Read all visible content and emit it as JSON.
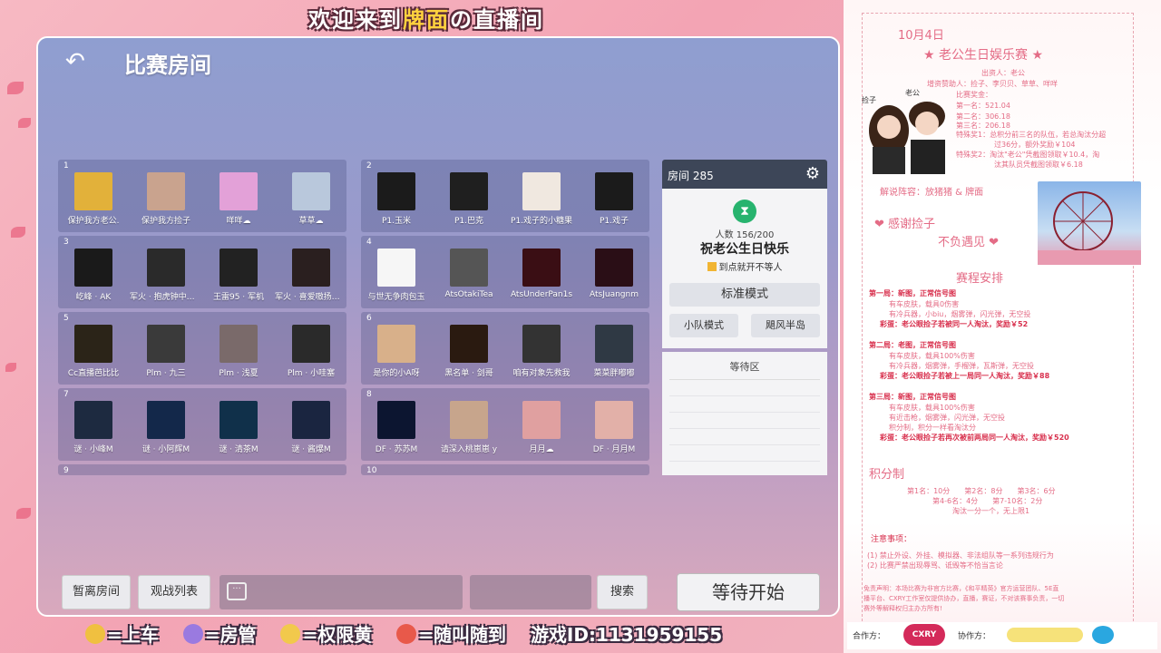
{
  "banner": {
    "part1": "欢迎来到",
    "highlight": "牌面",
    "part2": "の直播间"
  },
  "game": {
    "title": "比赛房间",
    "teams": [
      {
        "num": "1",
        "members": [
          {
            "name": "保护我方老公.",
            "color": "#e2b13a"
          },
          {
            "name": "保护我方捡子",
            "color": "#c9a38e"
          },
          {
            "name": "咩咩☁",
            "color": "#e3a1d8"
          },
          {
            "name": "草草☁",
            "color": "#b9c8dc"
          }
        ]
      },
      {
        "num": "2",
        "members": [
          {
            "name": "P1.玉米",
            "color": "#1b1b1b"
          },
          {
            "name": "P1.巴克",
            "color": "#1f1f1f"
          },
          {
            "name": "P1.戏子的小糖果",
            "color": "#f0e8e0"
          },
          {
            "name": "P1.戏子",
            "color": "#1b1b1b"
          }
        ]
      },
      {
        "num": "3",
        "members": [
          {
            "name": "屹峰 · AK",
            "color": "#1a1a1a"
          },
          {
            "name": "军火 · 抱虎钟中很苍鸭",
            "color": "#2a2a2a"
          },
          {
            "name": "王雷95 · 军机",
            "color": "#222"
          },
          {
            "name": "军火 · 喜爱嗷扬巴瓦别哥",
            "color": "#2a1f1f"
          }
        ]
      },
      {
        "num": "4",
        "members": [
          {
            "name": "与世无争肉包玉",
            "color": "#f6f6f6"
          },
          {
            "name": "AtsOtakiTea",
            "color": "#555"
          },
          {
            "name": "AtsUnderPan1s",
            "color": "#3a0e14"
          },
          {
            "name": "AtsJuangnm",
            "color": "#2a0e16"
          }
        ]
      },
      {
        "num": "5",
        "members": [
          {
            "name": "Cc直播芭比比",
            "color": "#2b2418"
          },
          {
            "name": "Plm · 九三",
            "color": "#3a3a3a"
          },
          {
            "name": "Plm · 浅夏",
            "color": "#7a6a6a"
          },
          {
            "name": "Plm · 小哇塞",
            "color": "#2a2a2a"
          }
        ]
      },
      {
        "num": "6",
        "members": [
          {
            "name": "是你的小A呀",
            "color": "#d8b08a"
          },
          {
            "name": "黑名单 · 剑哥",
            "color": "#2a1a10"
          },
          {
            "name": "咱有对象先救我",
            "color": "#333"
          },
          {
            "name": "菜菜胖嘟嘟",
            "color": "#2f3944"
          }
        ]
      },
      {
        "num": "7",
        "members": [
          {
            "name": "谜 · 小峰M",
            "color": "#1d2a40"
          },
          {
            "name": "谜 · 小阿辉M",
            "color": "#13284a"
          },
          {
            "name": "谜 · 清茶M",
            "color": "#10304a"
          },
          {
            "name": "谜 · 酱爆M",
            "color": "#1a2540"
          }
        ]
      },
      {
        "num": "8",
        "members": [
          {
            "name": "DF · 苏苏M",
            "color": "#0c1530"
          },
          {
            "name": "请深入桃崽崽 y",
            "color": "#c7a58c"
          },
          {
            "name": "月月☁",
            "color": "#e0a0a0"
          },
          {
            "name": "DF · 月月M",
            "color": "#e2b0a8"
          }
        ]
      },
      {
        "num": "9",
        "members": []
      },
      {
        "num": "10",
        "members": []
      }
    ],
    "room": {
      "label": "房间 285",
      "players": "人数 156/200",
      "name": "祝老公生日快乐",
      "note": "到点就开不等人",
      "mode_main": "标准模式",
      "mode_a": "小队模式",
      "mode_b": "飓风半岛",
      "waiting": "等待区"
    },
    "toolbar": {
      "afk_room": "暂离房间",
      "spectate": "观战列表",
      "search": "搜索",
      "start": "等待开始"
    }
  },
  "legend": {
    "car": "=上车",
    "admin": "=房管",
    "perm": "=权限黄",
    "random": "=随叫随到",
    "game_id": "游戏ID:1131959155"
  },
  "side": {
    "date": "10月4日",
    "title": "★ 老公生日娱乐赛 ★",
    "host": "出资人：老公",
    "sponsors": "增资赞助人：捡子、李贝贝、草草、咩咩",
    "prize_head": "比赛奖金：",
    "p1": "第一名：521.04",
    "p2": "第二名：306.18",
    "p3": "第三名：206.18",
    "special1a": "特殊奖1：总积分前三名的队伍，若总淘汰分超",
    "special1b": "过36分，额外奖励￥104",
    "special2a": "特殊奖2：淘汰\"老公\"凭截图领取￥10.4，淘",
    "special2b": "汰其队员凭截图领取￥6.18",
    "label_him": "老公",
    "label_her": "捡子",
    "commentary": "解说阵容：放猪猪 & 牌面",
    "thanks": "感谢捡子",
    "meet": "不负遇见",
    "schedule_title": "赛程安排",
    "r1": "第一局：新图，正常信号图",
    "r1a": "有车皮肤，载具0伤害",
    "r1b": "有冷兵器，小biu，烟雾弹，闪光弹，无空投",
    "r1egg": "彩蛋：老公眼捡子若被同一人淘汰，奖励￥52",
    "r2": "第二局：老图，正常信号图",
    "r2a": "有车皮肤，载具100%伤害",
    "r2b": "有冷兵器，烟雾弹，手榴弹，瓦斯弹，无空投",
    "r2egg": "彩蛋：老公眼捡子若被上一局同一人淘汰，奖励￥88",
    "r3": "第三局：新图，正常信号图",
    "r3a": "有车皮肤，载具100%伤害",
    "r3b": "有近击枪，烟雾弹，闪光弹，无空投",
    "r3c": "积分制，积分一样看淘汰分",
    "r3egg": "彩蛋：老公眼捡子若再次被前两局同一人淘汰，奖励￥520",
    "score_title": "积分制",
    "score1": "第1名：10分　　第2名：8分　　第3名：6分",
    "score2": "第4-6名：4分　　第7-10名：2分",
    "score3": "淘汰一分一个，无上限1",
    "notes_title": "注意事项：",
    "note1": "(1) 禁止外设、外挂、模拟器、非法组队等一系列违规行为",
    "note2": "(2) 比赛严禁出现辱骂、诋毁等不恰当言论",
    "disclaimer1": "免责声明：本场比赛为非官方比赛，《和平精英》官方运营团队、5E直",
    "disclaimer2": "播平台、CXRY工作室仅提供协办，直播，赛证，不对该赛事负责，一切",
    "disclaimer3": "赛外等解释权归主办方所有!",
    "partner": "合作方：",
    "coop": "协作方：",
    "logo_text": "CXRY"
  },
  "colors": {
    "accent": "#e46c86",
    "red": "#d8304d",
    "hourglass": "#27b36e"
  }
}
